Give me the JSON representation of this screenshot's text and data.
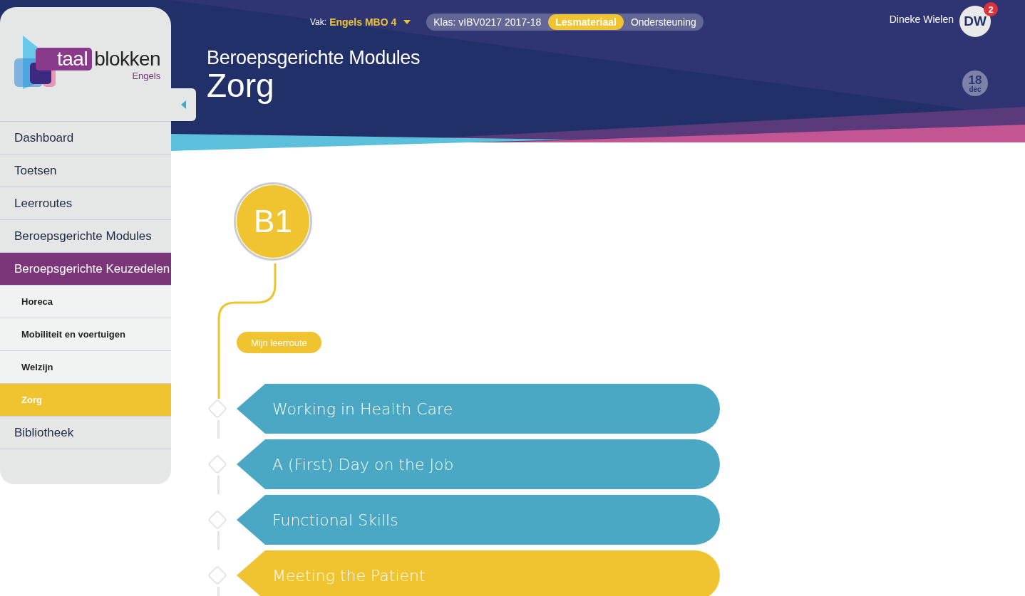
{
  "subject": {
    "label": "Vak:",
    "value": "Engels MBO 4"
  },
  "nav_pills": [
    {
      "label": "Klas: vIBV0217 2017-18",
      "selected": false
    },
    {
      "label": "Lesmateriaal",
      "selected": true
    },
    {
      "label": "Ondersteuning",
      "selected": false
    }
  ],
  "user": {
    "name": "Dineke Wielen",
    "initials": "DW",
    "notifications": "2"
  },
  "header": {
    "breadcrumb": "Beroepsgerichte Modules",
    "title": "Zorg",
    "date_day": "18",
    "date_month": "dec"
  },
  "logo": {
    "word_1": "taal",
    "word_2": "blokken",
    "subtitle": "Engels"
  },
  "sidebar": {
    "items": [
      {
        "label": "Dashboard",
        "selected": false
      },
      {
        "label": "Toetsen",
        "selected": false
      },
      {
        "label": "Leerroutes",
        "selected": false
      },
      {
        "label": "Beroepsgerichte Modules",
        "selected": false
      },
      {
        "label": "Beroepsgerichte Keuzedelen",
        "selected": true,
        "expanded": true,
        "children": [
          {
            "label": "Horeca",
            "selected": false
          },
          {
            "label": "Mobiliteit en voertuigen",
            "selected": false
          },
          {
            "label": "Welzijn",
            "selected": false
          },
          {
            "label": "Zorg",
            "selected": true
          }
        ]
      },
      {
        "label": "Bibliotheek",
        "selected": false
      }
    ]
  },
  "level": {
    "badge": "B1"
  },
  "route_button": "Mijn leerroute",
  "modules": [
    {
      "title": "Working in Health Care",
      "color": "#4aa8c4"
    },
    {
      "title": "A (First) Day on the Job",
      "color": "#4aa8c4"
    },
    {
      "title": "Functional Skills",
      "color": "#4aa8c4"
    },
    {
      "title": "Meeting the Patient",
      "color": "#f0c330"
    }
  ]
}
